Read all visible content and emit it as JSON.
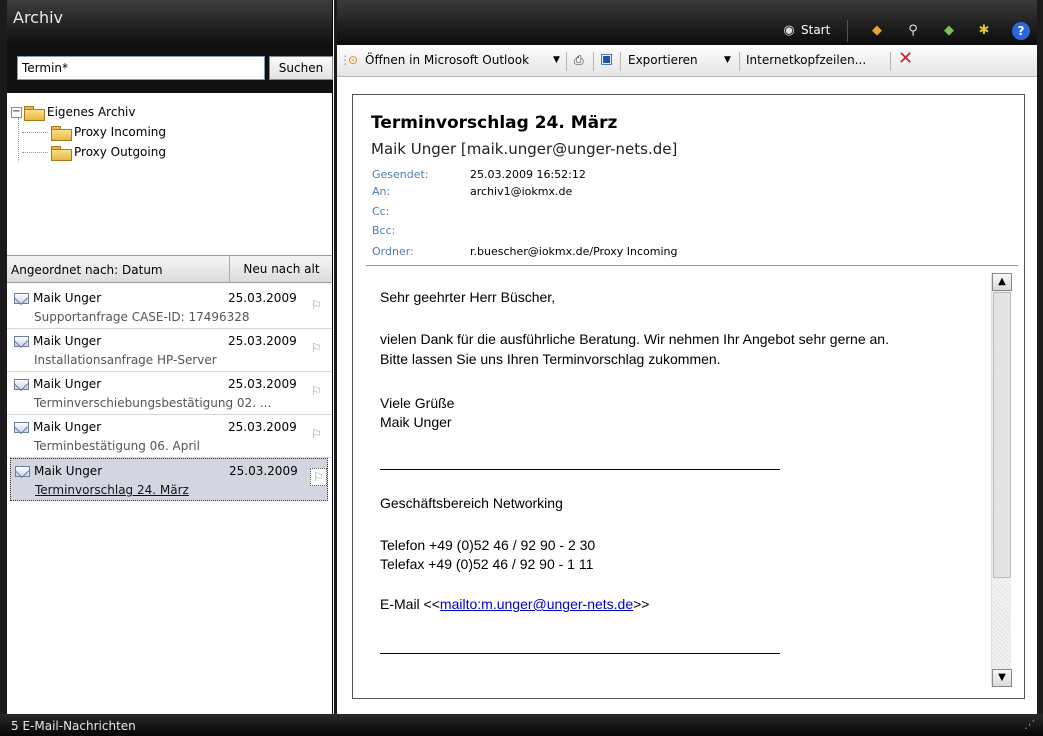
{
  "left_pane": {
    "title": "Archiv",
    "search": {
      "value": "Termin*",
      "button_label": "Suchen"
    },
    "tree": {
      "root": {
        "toggle": "−",
        "label": "Eigenes Archiv"
      },
      "children": [
        {
          "label": "Proxy Incoming"
        },
        {
          "label": "Proxy Outgoing"
        }
      ]
    },
    "sort": {
      "label": "Angeordnet nach: Datum",
      "order": "Neu nach alt"
    },
    "mails": [
      {
        "sender": "Maik Unger",
        "date": "25.03.2009",
        "subject": "Supportanfrage CASE-ID: 17496328"
      },
      {
        "sender": "Maik Unger",
        "date": "25.03.2009",
        "subject": "Installationsanfrage HP-Server"
      },
      {
        "sender": "Maik Unger",
        "date": "25.03.2009",
        "subject": "Terminverschiebungsbestätigung 02. ..."
      },
      {
        "sender": "Maik Unger",
        "date": "25.03.2009",
        "subject": "Terminbestätigung 06. April"
      },
      {
        "sender": "Maik Unger",
        "date": "25.03.2009",
        "subject": "Terminvorschlag 24. März"
      }
    ]
  },
  "top_bar": {
    "start_label": "Start"
  },
  "toolbar": {
    "open_outlook": "Öffnen in Microsoft Outlook",
    "export": "Exportieren",
    "headers": "Internetkopfzeilen..."
  },
  "message": {
    "subject": "Terminvorschlag 24. März",
    "from": "Maik Unger [maik.unger@unger-nets.de]",
    "headers": {
      "sent_label": "Gesendet:",
      "sent": "25.03.2009 16:52:12",
      "to_label": "An:",
      "to": "archiv1@iokmx.de",
      "cc_label": "Cc:",
      "cc": "",
      "bcc_label": "Bcc:",
      "bcc": "",
      "folder_label": "Ordner:",
      "folder": "r.buescher@iokmx.de/Proxy Incoming"
    },
    "body": {
      "greeting": "Sehr geehrter Herr Büscher,",
      "para1_line1": "vielen Dank für die ausführliche Beratung. Wir nehmen Ihr Angebot sehr gerne an.",
      "para1_line2": "Bitte lassen Sie uns Ihren Terminvorschlag zukommen.",
      "closing": "Viele Grüße",
      "signature": "Maik  Unger",
      "department": "Geschäftsbereich Networking",
      "phone": "Telefon   +49 (0)52 46 / 92 90 - 2 30",
      "fax": "Telefax   +49 (0)52 46 / 92 90 - 1 11",
      "email_prefix": "E-Mail  <<",
      "email_link": "mailto:m.unger@unger-nets.de",
      "email_suffix": ">>"
    }
  },
  "status_bar": {
    "text": "5 E-Mail-Nachrichten"
  }
}
